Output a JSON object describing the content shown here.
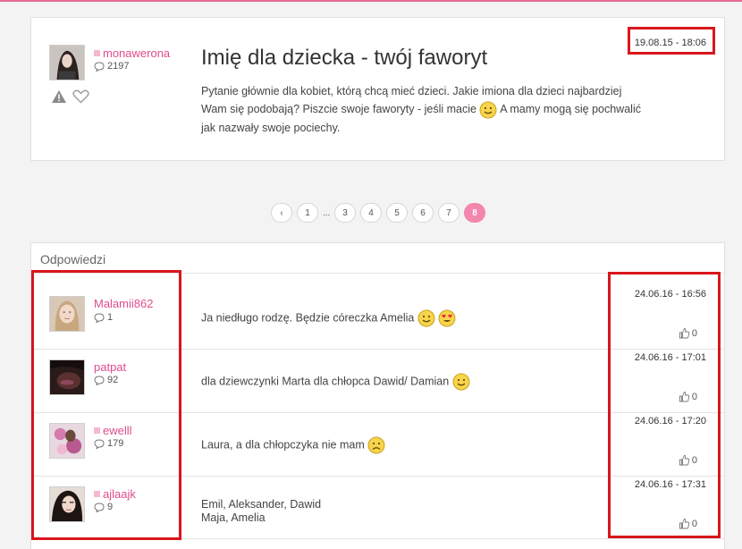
{
  "post": {
    "username": "monawerona",
    "comment_count": "2197",
    "title": "Imię dla dziecka - twój faworyt",
    "body_part1": "Pytanie głównie dla kobiet, którą chcą mieć dzieci. Jakie imiona dla dzieci najbardziej Wam się podobają? Piszcie swoje faworyty - jeśli macie",
    "body_part2": " A mamy mogą się pochwalić jak nazwały swoje pociechy.",
    "date": "19.08.15 - 18:06",
    "icons": [
      "warning-icon",
      "heart-icon",
      "smile-emoji"
    ]
  },
  "pagination": {
    "prev": "‹",
    "pages": [
      "1",
      "...",
      "3",
      "4",
      "5",
      "6",
      "7",
      "8"
    ],
    "active": "8"
  },
  "replies": {
    "heading": "Odpowiedzi",
    "items": [
      {
        "username": "Malamii862",
        "online": false,
        "count": "1",
        "text": "Ja niedługo rodzę. Będzie córeczka Amelia",
        "date": "24.06.16 - 16:56",
        "likes": "0",
        "emojis": [
          "smile",
          "heart-eyes"
        ]
      },
      {
        "username": "patpat",
        "online": false,
        "count": "92",
        "text": "dla dziewczynki Marta dla chłopca Dawid/ Damian",
        "date": "24.06.16 - 17:01",
        "likes": "0",
        "emojis": [
          "smile"
        ]
      },
      {
        "username": "ewelll",
        "online": true,
        "count": "179",
        "text": "Laura, a dla chłopczyka nie mam",
        "date": "24.06.16 - 17:20",
        "likes": "0",
        "emojis": [
          "sad"
        ]
      },
      {
        "username": "ajlaajk",
        "online": true,
        "count": "9",
        "text_line1": "Emil, Aleksander, Dawid",
        "text_line2": "Maja, Amelia",
        "date": "24.06.16 - 17:31",
        "likes": "0",
        "emojis": []
      }
    ]
  },
  "colors": {
    "accent_pink": "#e04d8c",
    "active_page": "#f386ad",
    "highlight_red": "#d9161c"
  }
}
